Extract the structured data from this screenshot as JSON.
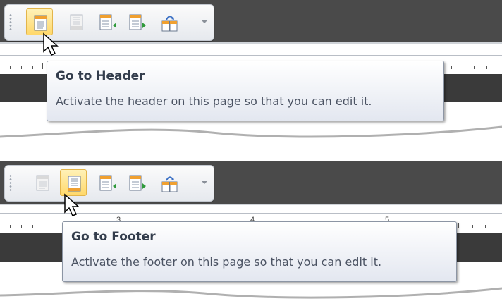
{
  "toolbar": {
    "buttons": [
      {
        "icon": "go-to-header-icon"
      },
      {
        "icon": "go-to-footer-icon"
      },
      {
        "icon": "show-previous-icon"
      },
      {
        "icon": "show-next-icon"
      },
      {
        "icon": "link-to-previous-icon"
      }
    ],
    "accent": "#f0a030",
    "hot_color": "#ffd86b"
  },
  "panels": {
    "top": {
      "hover_button": "go-to-header",
      "tooltip": {
        "title": "Go to Header",
        "description": "Activate the header on this page so that you can edit it."
      }
    },
    "bottom": {
      "hover_button": "go-to-footer",
      "ruler_numbers": [
        "3",
        "4",
        "5"
      ],
      "tooltip": {
        "title": "Go to Footer",
        "description": "Activate the footer on this page so that you can edit it."
      }
    }
  }
}
